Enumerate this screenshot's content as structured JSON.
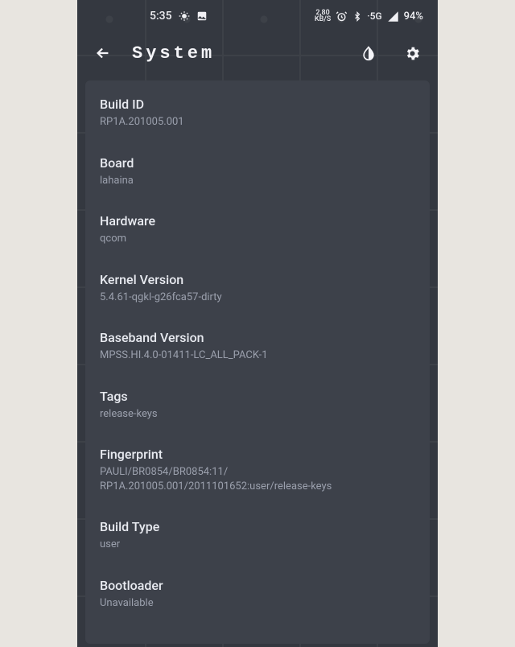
{
  "status_bar": {
    "time": "5:35",
    "kbs_top": "2,80",
    "kbs_bottom": "KB/S",
    "network": "5G",
    "battery": "94%"
  },
  "appbar": {
    "title": "System"
  },
  "rows": [
    {
      "label": "Build ID",
      "value": "RP1A.201005.001"
    },
    {
      "label": "Board",
      "value": "lahaina"
    },
    {
      "label": "Hardware",
      "value": "qcom"
    },
    {
      "label": "Kernel Version",
      "value": "5.4.61-qgkl-g26fca57-dirty"
    },
    {
      "label": "Baseband Version",
      "value": "MPSS.HI.4.0-01411-LC_ALL_PACK-1"
    },
    {
      "label": "Tags",
      "value": "release-keys"
    },
    {
      "label": "Fingerprint",
      "value": "PAULI/BR0854/BR0854:11/\nRP1A.201005.001/2011101652:user/release-keys"
    },
    {
      "label": "Build Type",
      "value": "user"
    },
    {
      "label": "Bootloader",
      "value": "Unavailable"
    }
  ]
}
